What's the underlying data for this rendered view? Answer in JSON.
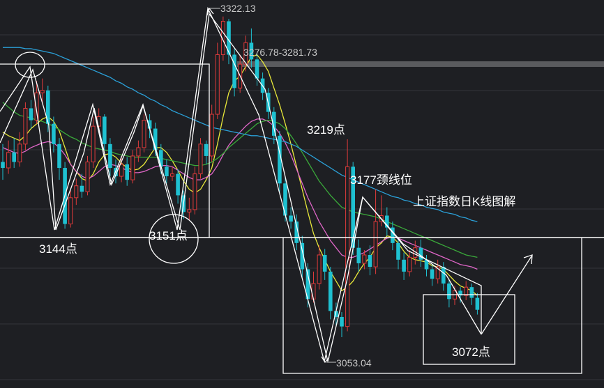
{
  "chart_data": {
    "type": "candlestick",
    "title": "上证指数日K线图解",
    "y_range": [
      3032,
      3330
    ],
    "price_labels": {
      "high": "3322.13",
      "low": "3053.04",
      "gap_zone": "3276.78-3281.73"
    },
    "annotations": [
      {
        "text": "3144点",
        "price": 3144
      },
      {
        "text": "3151点",
        "price": 3151
      },
      {
        "text": "3219点",
        "price": 3219
      },
      {
        "text": "3177颈线位",
        "price": 3177
      },
      {
        "text": "3072点",
        "price": 3072
      }
    ],
    "candles": [
      [
        3200,
        3195,
        3215,
        3185
      ],
      [
        3195,
        3208,
        3218,
        3190
      ],
      [
        3208,
        3200,
        3220,
        3195
      ],
      [
        3200,
        3215,
        3225,
        3196
      ],
      [
        3215,
        3245,
        3250,
        3210
      ],
      [
        3245,
        3235,
        3252,
        3228
      ],
      [
        3235,
        3258,
        3268,
        3232
      ],
      [
        3258,
        3260,
        3270,
        3250
      ],
      [
        3260,
        3232,
        3264,
        3225
      ],
      [
        3232,
        3215,
        3238,
        3208
      ],
      [
        3215,
        3195,
        3220,
        3185
      ],
      [
        3195,
        3148,
        3200,
        3144
      ],
      [
        3148,
        3170,
        3176,
        3145
      ],
      [
        3170,
        3180,
        3186,
        3164
      ],
      [
        3180,
        3175,
        3190,
        3170
      ],
      [
        3175,
        3200,
        3205,
        3172
      ],
      [
        3200,
        3230,
        3238,
        3195
      ],
      [
        3230,
        3238,
        3245,
        3225
      ],
      [
        3238,
        3215,
        3240,
        3210
      ],
      [
        3215,
        3195,
        3220,
        3188
      ],
      [
        3195,
        3188,
        3202,
        3182
      ],
      [
        3188,
        3198,
        3205,
        3183
      ],
      [
        3198,
        3185,
        3204,
        3180
      ],
      [
        3185,
        3205,
        3210,
        3182
      ],
      [
        3205,
        3212,
        3218,
        3200
      ],
      [
        3212,
        3235,
        3240,
        3208
      ],
      [
        3235,
        3228,
        3240,
        3220
      ],
      [
        3228,
        3210,
        3233,
        3205
      ],
      [
        3210,
        3196,
        3215,
        3190
      ],
      [
        3196,
        3188,
        3202,
        3182
      ],
      [
        3188,
        3190,
        3196,
        3184
      ],
      [
        3190,
        3172,
        3194,
        3165
      ],
      [
        3172,
        3158,
        3176,
        3152
      ],
      [
        3158,
        3160,
        3170,
        3151
      ],
      [
        3160,
        3190,
        3196,
        3156
      ],
      [
        3190,
        3215,
        3220,
        3186
      ],
      [
        3215,
        3205,
        3218,
        3198
      ],
      [
        3205,
        3240,
        3248,
        3200
      ],
      [
        3240,
        3290,
        3300,
        3236
      ],
      [
        3290,
        3318,
        3322,
        3285
      ],
      [
        3318,
        3290,
        3320,
        3282
      ],
      [
        3290,
        3262,
        3295,
        3255
      ],
      [
        3262,
        3282,
        3290,
        3258
      ],
      [
        3282,
        3300,
        3306,
        3276
      ],
      [
        3300,
        3286,
        3312,
        3279
      ],
      [
        3286,
        3270,
        3291,
        3264
      ],
      [
        3270,
        3258,
        3275,
        3252
      ],
      [
        3258,
        3242,
        3262,
        3236
      ],
      [
        3242,
        3222,
        3246,
        3215
      ],
      [
        3222,
        3182,
        3226,
        3175
      ],
      [
        3182,
        3155,
        3188,
        3150
      ],
      [
        3155,
        3150,
        3162,
        3144
      ],
      [
        3150,
        3132,
        3156,
        3126
      ],
      [
        3132,
        3110,
        3138,
        3103
      ],
      [
        3110,
        3085,
        3115,
        3078
      ],
      [
        3085,
        3098,
        3108,
        3082
      ],
      [
        3098,
        3122,
        3130,
        3093
      ],
      [
        3122,
        3108,
        3127,
        3101
      ],
      [
        3108,
        3075,
        3112,
        3068
      ],
      [
        3075,
        3070,
        3082,
        3063
      ],
      [
        3070,
        3062,
        3074,
        3053
      ],
      [
        3062,
        3196,
        3219,
        3058
      ],
      [
        3196,
        3128,
        3200,
        3122
      ],
      [
        3128,
        3115,
        3135,
        3108
      ],
      [
        3115,
        3122,
        3126,
        3110
      ],
      [
        3122,
        3112,
        3130,
        3105
      ],
      [
        3112,
        3150,
        3177,
        3106
      ],
      [
        3150,
        3155,
        3172,
        3146
      ],
      [
        3155,
        3145,
        3162,
        3138
      ],
      [
        3145,
        3132,
        3150,
        3126
      ],
      [
        3132,
        3118,
        3136,
        3110
      ],
      [
        3118,
        3108,
        3124,
        3101
      ],
      [
        3108,
        3120,
        3126,
        3104
      ],
      [
        3120,
        3128,
        3134,
        3114
      ],
      [
        3128,
        3118,
        3135,
        3112
      ],
      [
        3118,
        3110,
        3122,
        3104
      ],
      [
        3110,
        3102,
        3114,
        3096
      ],
      [
        3102,
        3112,
        3118,
        3098
      ],
      [
        3112,
        3098,
        3116,
        3092
      ],
      [
        3098,
        3085,
        3102,
        3078
      ],
      [
        3085,
        3092,
        3096,
        3080
      ],
      [
        3092,
        3088,
        3095,
        3082
      ],
      [
        3088,
        3095,
        3100,
        3084
      ],
      [
        3095,
        3086,
        3098,
        3080
      ],
      [
        3086,
        3076,
        3090,
        3072
      ]
    ],
    "ma_lines": [
      {
        "color": "#e8e83a",
        "values": [
          3225,
          3222,
          3220,
          3218,
          3222,
          3228,
          3232,
          3236,
          3238,
          3234,
          3226,
          3212,
          3198,
          3192,
          3186,
          3184,
          3190,
          3200,
          3206,
          3207,
          3204,
          3199,
          3195,
          3193,
          3194,
          3198,
          3205,
          3212,
          3212,
          3208,
          3201,
          3193,
          3184,
          3177,
          3174,
          3177,
          3185,
          3195,
          3215,
          3238,
          3258,
          3268,
          3272,
          3280,
          3288,
          3290,
          3284,
          3276,
          3262,
          3248,
          3232,
          3215,
          3196,
          3177,
          3158,
          3140,
          3128,
          3118,
          3108,
          3100,
          3092,
          3095,
          3100,
          3108,
          3115,
          3120,
          3128,
          3132,
          3138,
          3137,
          3132,
          3125,
          3120,
          3118,
          3117,
          3116,
          3113,
          3112,
          3110,
          3105,
          3100,
          3096,
          3094,
          3092,
          3088
        ]
      },
      {
        "color": "#e066c8",
        "values": [
          3212,
          3210,
          3208,
          3207,
          3209,
          3212,
          3214,
          3216,
          3217,
          3216,
          3212,
          3206,
          3198,
          3192,
          3188,
          3186,
          3188,
          3192,
          3196,
          3198,
          3197,
          3195,
          3193,
          3191,
          3191,
          3192,
          3194,
          3196,
          3197,
          3197,
          3196,
          3193,
          3190,
          3187,
          3185,
          3185,
          3187,
          3190,
          3197,
          3206,
          3214,
          3220,
          3225,
          3230,
          3234,
          3236,
          3236,
          3234,
          3230,
          3224,
          3216,
          3206,
          3194,
          3182,
          3170,
          3160,
          3150,
          3142,
          3134,
          3128,
          3122,
          3120,
          3120,
          3122,
          3124,
          3127,
          3130,
          3133,
          3136,
          3137,
          3136,
          3134,
          3132,
          3130,
          3128,
          3126,
          3124,
          3122,
          3120,
          3118,
          3116,
          3114,
          3113,
          3112,
          3110
        ]
      },
      {
        "color": "#3aa83a",
        "values": [
          3250,
          3246,
          3242,
          3239,
          3238,
          3237,
          3235,
          3234,
          3232,
          3230,
          3227,
          3224,
          3221,
          3219,
          3216,
          3214,
          3212,
          3211,
          3210,
          3209,
          3207,
          3206,
          3205,
          3204,
          3204,
          3204,
          3204,
          3204,
          3203,
          3202,
          3201,
          3200,
          3199,
          3198,
          3197,
          3197,
          3198,
          3200,
          3203,
          3207,
          3212,
          3216,
          3220,
          3224,
          3228,
          3232,
          3234,
          3235,
          3234,
          3232,
          3228,
          3222,
          3215,
          3208,
          3200,
          3192,
          3184,
          3178,
          3172,
          3167,
          3162,
          3160,
          3158,
          3157,
          3156,
          3155,
          3154,
          3152,
          3150,
          3148,
          3146,
          3144,
          3142,
          3140,
          3138,
          3136,
          3134,
          3132,
          3130,
          3128,
          3126,
          3124,
          3122,
          3121,
          3120
        ]
      },
      {
        "color": "#2ba0d8",
        "values": [
          3296,
          3296,
          3296,
          3296,
          3295,
          3295,
          3294,
          3293,
          3292,
          3291,
          3289,
          3287,
          3285,
          3283,
          3281,
          3279,
          3277,
          3275,
          3273,
          3271,
          3268,
          3266,
          3263,
          3261,
          3258,
          3256,
          3253,
          3251,
          3248,
          3246,
          3243,
          3241,
          3239,
          3237,
          3235,
          3233,
          3231,
          3229,
          3228,
          3227,
          3226,
          3225,
          3224,
          3223,
          3222,
          3222,
          3221,
          3220,
          3219,
          3218,
          3217,
          3215,
          3213,
          3210,
          3207,
          3204,
          3201,
          3198,
          3195,
          3192,
          3189,
          3187,
          3185,
          3183,
          3181,
          3179,
          3177,
          3175,
          3173,
          3171,
          3170,
          3168,
          3167,
          3165,
          3164,
          3162,
          3161,
          3160,
          3158,
          3157,
          3156,
          3154,
          3153,
          3151,
          3150
        ]
      }
    ],
    "grid": true,
    "up_color": "#e03b3b",
    "down_color": "#1fc1d1"
  }
}
